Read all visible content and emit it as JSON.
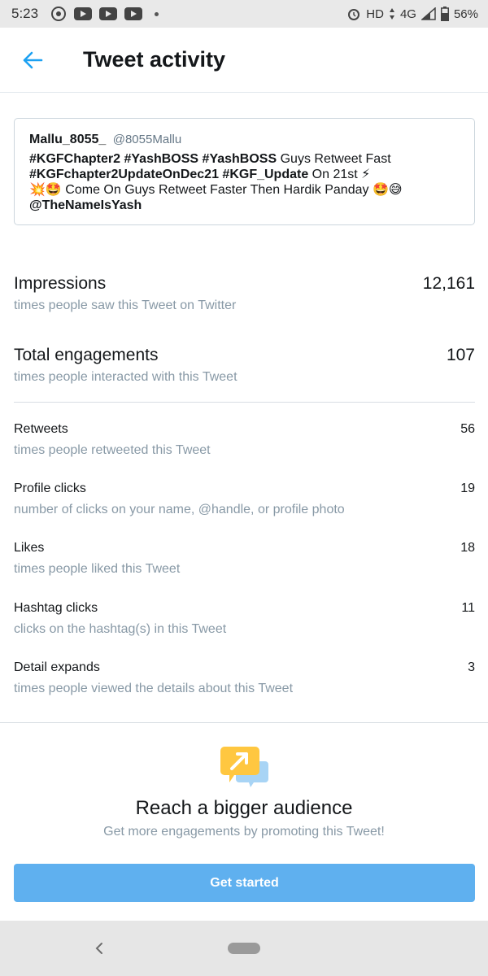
{
  "status_bar": {
    "time": "5:23",
    "network": "HD",
    "signal_type": "4G",
    "battery": "56%"
  },
  "header": {
    "title": "Tweet activity"
  },
  "tweet": {
    "name": "Mallu_8055_",
    "handle": "@8055Mallu",
    "line1_tag1": "#KGFChapter2",
    "line1_tag2": "#YashBOSS",
    "line1_tag3": "#YashBOSS",
    "line1_text": " Guys Retweet Fast",
    "line2_tag1": "#KGFchapter2UpdateOnDec21",
    "line2_tag2": "#KGF_Update",
    "line2_text": " On 21st ⚡",
    "line3_text": "💥🤩 Come On Guys Retweet Faster Then Hardik Panday 🤩😅",
    "mention": "@TheNameIsYash"
  },
  "metrics": {
    "impressions": {
      "label": "Impressions",
      "sub": "times people saw this Tweet on Twitter",
      "value": "12,161"
    },
    "engagements": {
      "label": "Total engagements",
      "sub": "times people interacted with this Tweet",
      "value": "107"
    },
    "retweets": {
      "label": "Retweets",
      "sub": "times people retweeted this Tweet",
      "value": "56"
    },
    "profile_clicks": {
      "label": "Profile clicks",
      "sub": "number of clicks on your name, @handle, or profile photo",
      "value": "19"
    },
    "likes": {
      "label": "Likes",
      "sub": "times people liked this Tweet",
      "value": "18"
    },
    "hashtag_clicks": {
      "label": "Hashtag clicks",
      "sub": "clicks on the hashtag(s) in this Tweet",
      "value": "11"
    },
    "detail_expands": {
      "label": "Detail expands",
      "sub": "times people viewed the details about this Tweet",
      "value": "3"
    }
  },
  "promo": {
    "title": "Reach a bigger audience",
    "subtitle": "Get more engagements by promoting this Tweet!",
    "button_label": "Get started"
  },
  "colors": {
    "accent": "#1da1f2",
    "button": "#5fb0ef",
    "promo_yellow": "#ffc740",
    "promo_blue": "#a8d4f5"
  }
}
